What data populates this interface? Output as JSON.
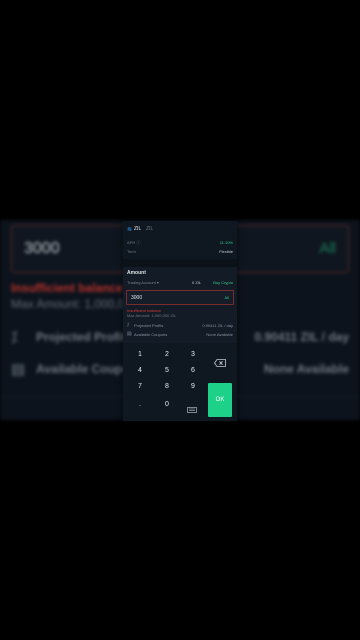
{
  "background": {
    "amount_value": "3000",
    "all_label": "All",
    "error_text": "Insufficient balance",
    "max_text": "Max Amount: 1,000,0",
    "projected_label": "Projected Profits",
    "projected_value": "0.90411 ZIL / day",
    "coupons_label": "Available Coupo",
    "coupons_value": "None Available"
  },
  "panel": {
    "coin": "ZIL",
    "coin_secondary": "ZIL",
    "apr_label": "APR ⓘ",
    "apr_value": "11.10%",
    "term_label": "Term",
    "term_value": "Flexible",
    "amount_title": "Amount",
    "account_label": "Trading Account ▾",
    "balance_value": "0 ZIL",
    "buy_label": "Buy Crypto",
    "input_value": "3000",
    "input_all": "All",
    "error_text": "Insufficient balance",
    "max_text": "Max Amount: 1,000,000 ZIL",
    "projected_label": "Projected Profits",
    "projected_value": "0.90411 ZIL / day",
    "coupons_label": "Available Coupons",
    "coupons_value": "None Available"
  },
  "keypad": {
    "keys": [
      "1",
      "2",
      "3",
      "4",
      "5",
      "6",
      "7",
      "8",
      "9",
      ".",
      "0"
    ],
    "ok_label": "OK"
  },
  "colors": {
    "accent_green": "#1ed189",
    "error_red": "#d33a32",
    "panel_bg": "#121b26"
  }
}
